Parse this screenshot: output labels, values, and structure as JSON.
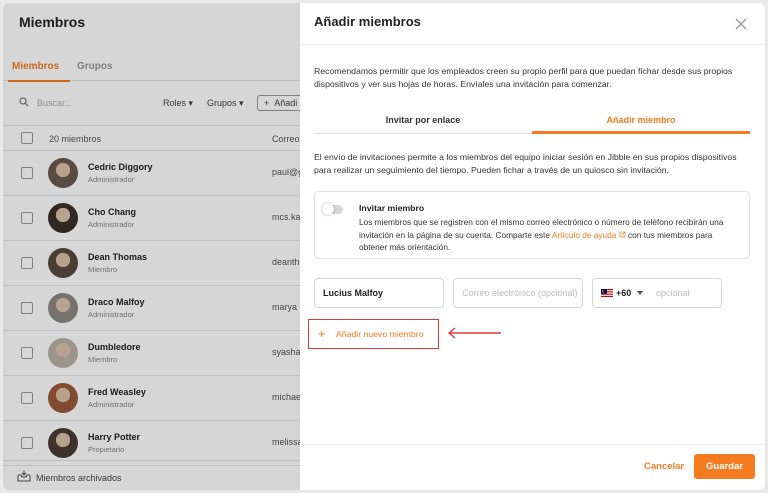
{
  "members_page": {
    "title": "Miembros",
    "tabs": [
      "Miembros",
      "Grupos"
    ],
    "search_placeholder": "Buscar...",
    "filters": [
      "Roles",
      "Grupos"
    ],
    "add_label": "Añadi",
    "header": {
      "count": "20 miembros",
      "email_col": "Correo"
    },
    "rows": [
      {
        "name": "Cedric Diggory",
        "role": "Administrador",
        "email": "paul@g",
        "avatar_color": "#6b5a4e"
      },
      {
        "name": "Cho Chang",
        "role": "Administrador",
        "email": "mcs.ka",
        "avatar_color": "#3b3029"
      },
      {
        "name": "Dean Thomas",
        "role": "Miembro",
        "email": "deanth",
        "avatar_color": "#5a4a3f"
      },
      {
        "name": "Draco Malfoy",
        "role": "Administrador",
        "email": "marya",
        "avatar_color": "#8d8a84"
      },
      {
        "name": "Dumbledore",
        "role": "Miembro",
        "email": "syasha",
        "avatar_color": "#b9b2a7"
      },
      {
        "name": "Fred Weasley",
        "role": "Administrador",
        "email": "michae",
        "avatar_color": "#9a5a3a"
      },
      {
        "name": "Harry Potter",
        "role": "Propietario",
        "email": "melissa",
        "avatar_color": "#4a3d35"
      }
    ],
    "archived_label": "Miembros archivados"
  },
  "modal": {
    "title": "Añadir miembros",
    "intro": "Recomendamos permitir que los empleados creen su propio perfil para que puedan fichar desde sus propios dispositivos y ver sus hojas de horas. Envíales una invitación para comenzar.",
    "tabs": {
      "by_link": "Invitar por enlace",
      "add_member": "Añadir miembro"
    },
    "description": "El envío de invitaciones permite a los miembros del equipo iniciar sesión en Jibble en sus propios dispositivos para realizar un seguimiento del tiempo. Pueden fichar a través de un quiosco sin invitación.",
    "invite": {
      "title": "Invitar miembro",
      "text_before": "Los miembros que se registren con el mismo correo electrónico o número de teléfono recibirán una invitación en la página de su cuenta. Comparte este ",
      "link": "Artículo de ayuda",
      "text_after": " con tus miembros para obtener más orientación.",
      "enabled": false
    },
    "form": {
      "name_value": "Lucius Malfoy",
      "email_placeholder": "Correo electrónico (opcional)",
      "country_code": "+60",
      "phone_placeholder": "opcional"
    },
    "add_new_label": "Añadir nuevo miembro",
    "cancel_label": "Cancelar",
    "save_label": "Guardar"
  },
  "colors": {
    "accent": "#f47b20",
    "highlight": "#d63c3c"
  }
}
